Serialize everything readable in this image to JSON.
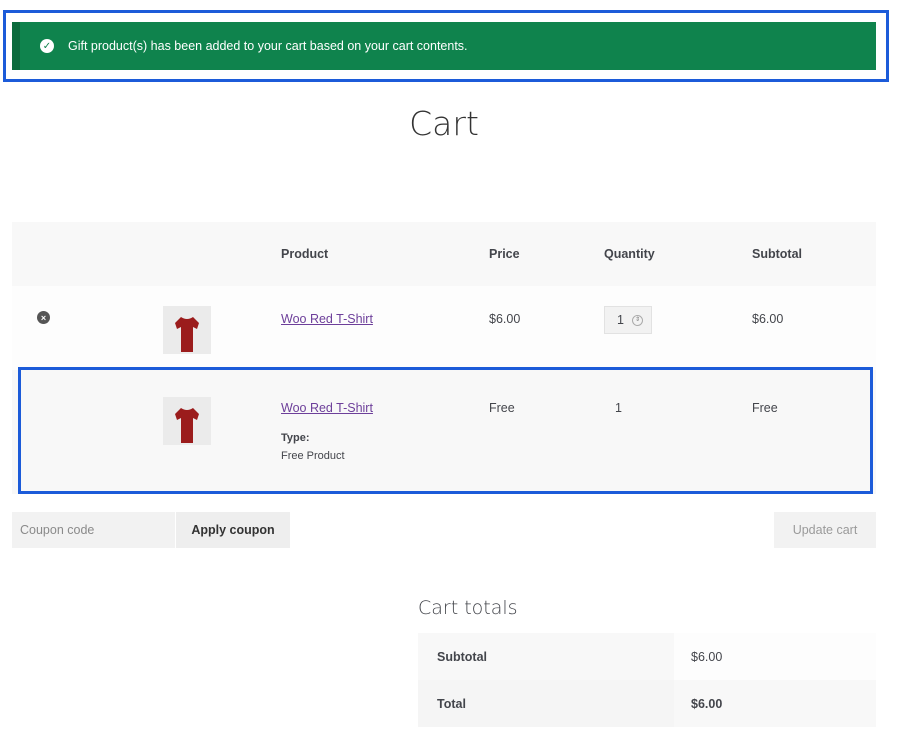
{
  "notice": {
    "message": "Gift product(s) has been added to your cart based on your cart contents.",
    "icon": "check-circle-icon",
    "color": "#0f834d"
  },
  "page": {
    "title": "Cart"
  },
  "table": {
    "headers": {
      "product": "Product",
      "price": "Price",
      "quantity": "Quantity",
      "subtotal": "Subtotal"
    },
    "rows": [
      {
        "product": "Woo Red T-Shirt",
        "price": "$6.00",
        "quantity": "1",
        "subtotal": "$6.00"
      },
      {
        "product": "Woo Red T-Shirt",
        "price": "Free",
        "quantity": "1",
        "subtotal": "Free",
        "meta_label": "Type:",
        "meta_value": "Free Product"
      }
    ]
  },
  "actions": {
    "coupon_placeholder": "Coupon code",
    "apply_label": "Apply coupon",
    "update_label": "Update cart"
  },
  "totals": {
    "title": "Cart totals",
    "subtotal_label": "Subtotal",
    "subtotal_value": "$6.00",
    "total_label": "Total",
    "total_value": "$6.00"
  },
  "colors": {
    "highlight": "#1c5bd9",
    "link": "#6d3f9a",
    "shirt": "#9b1c1c"
  }
}
